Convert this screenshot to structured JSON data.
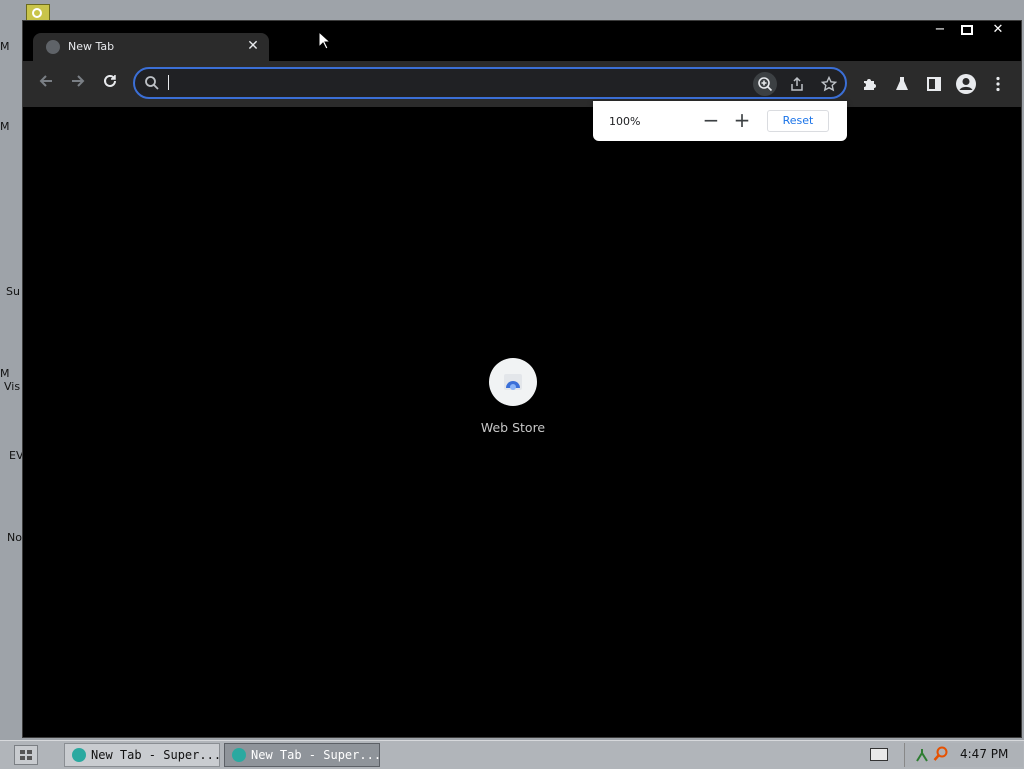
{
  "desktop": {
    "icon_labels": [
      "M",
      "M",
      "Su",
      "M",
      "Vis",
      "EV",
      "No"
    ]
  },
  "tab": {
    "title": "New Tab"
  },
  "omnibox": {
    "value": "",
    "placeholder": ""
  },
  "zoom_popup": {
    "value": "100%",
    "reset_label": "Reset"
  },
  "shortcuts": [
    {
      "label": "Web Store"
    }
  ],
  "taskbar": {
    "buttons": [
      {
        "label": "New Tab - Super..."
      },
      {
        "label": "New Tab - Super..."
      }
    ],
    "clock": "4:47 PM"
  },
  "colors": {
    "accent": "#3b6fd6",
    "toolbar": "#2b2b2b",
    "page_bg": "#000000",
    "desktop_bg": "#9ea3a9"
  }
}
